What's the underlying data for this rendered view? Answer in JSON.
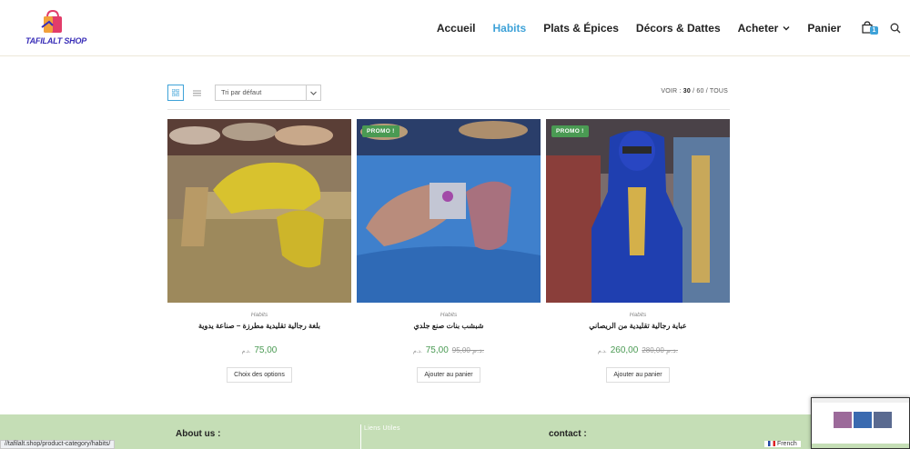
{
  "header": {
    "logo_text": "TAFILALT SHOP",
    "nav": [
      {
        "label": "Accueil",
        "active": false
      },
      {
        "label": "Habits",
        "active": true
      },
      {
        "label": "Plats & Épices",
        "active": false
      },
      {
        "label": "Décors & Dattes",
        "active": false
      },
      {
        "label": "Acheter",
        "active": false
      },
      {
        "label": "Panier",
        "active": false
      }
    ],
    "cart_count": "1",
    "accent_color": "#3ea2d8"
  },
  "toolbar": {
    "sort_value": "Tri par défaut",
    "voir_label": "VOIR :",
    "voir_options": [
      "30",
      "60",
      "TOUS"
    ]
  },
  "products": [
    {
      "category": "Habits",
      "title": "بلغة رجالية تقليدية مطرزة – صناعة يدوية",
      "promo": "",
      "old_price": "",
      "price": "75,00",
      "currency": "د.م.",
      "button": "Choix des options"
    },
    {
      "category": "Habits",
      "title": "شبشب بنات صنع جلدي",
      "promo": "PROMO !",
      "old_price": "95,00 د.م.",
      "price": "75,00",
      "currency": "د.م.",
      "button": "Ajouter au panier"
    },
    {
      "category": "Habits",
      "title": "عباية رجالية تقليدية من الريصاني",
      "promo": "PROMO !",
      "old_price": "280,00 د.م.",
      "price": "260,00",
      "currency": "د.م.",
      "button": "Ajouter au panier"
    }
  ],
  "footer": {
    "about": "About us :",
    "links": "Liens Utiles",
    "contact": "contact :",
    "status_url": "//tafilalt.shop/product-category/habits/",
    "language": "French"
  }
}
